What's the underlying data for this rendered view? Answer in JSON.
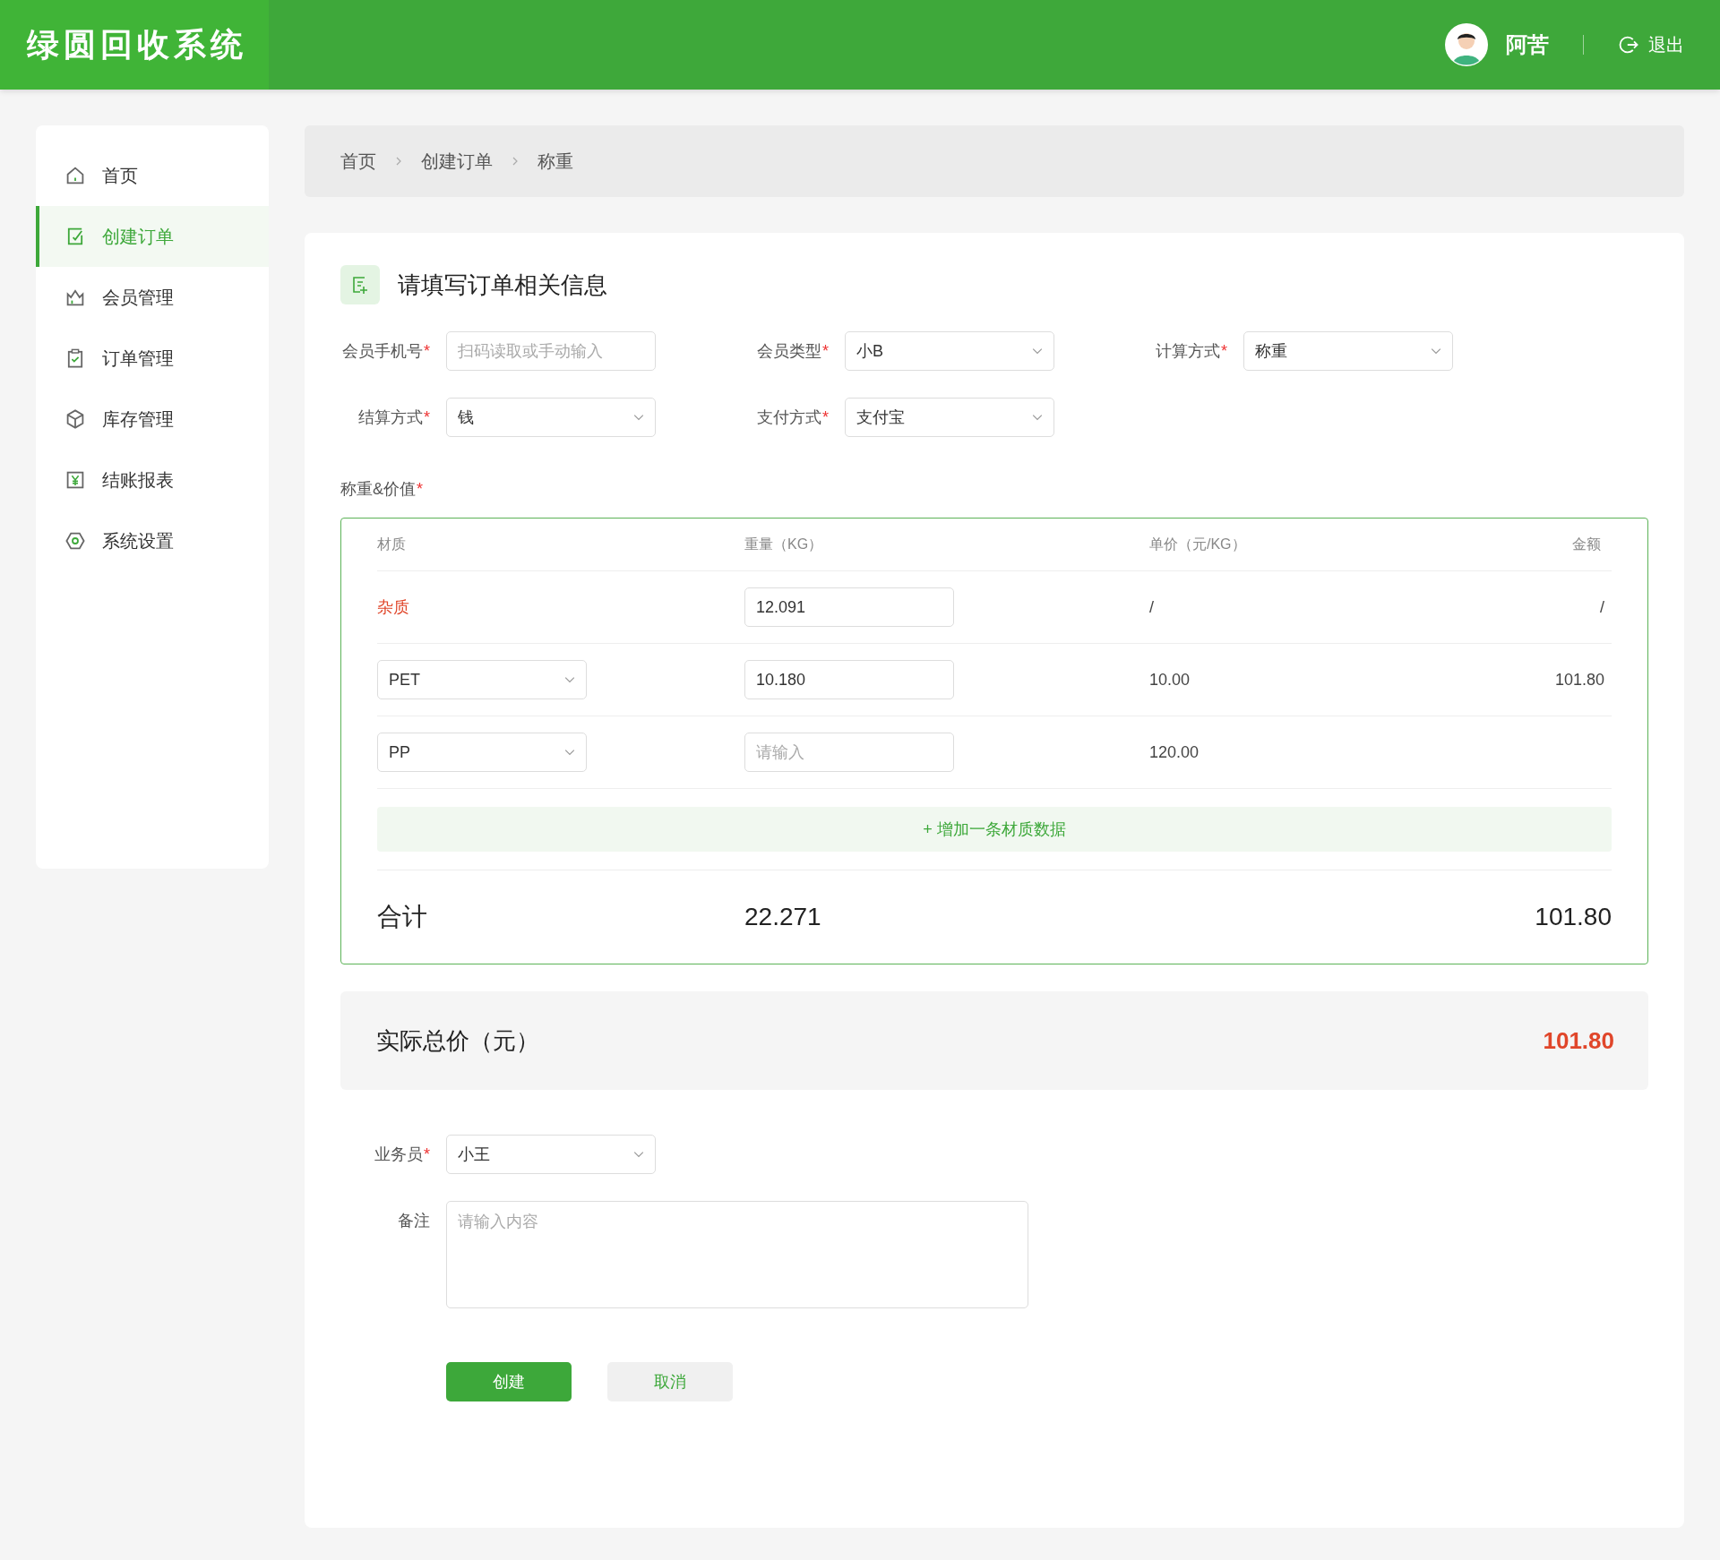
{
  "app_title": "绿圆回收系统",
  "user": {
    "name": "阿苦",
    "logout": "退出"
  },
  "sidebar": {
    "items": [
      {
        "label": "首页",
        "selected": false
      },
      {
        "label": "创建订单",
        "selected": true
      },
      {
        "label": "会员管理",
        "selected": false
      },
      {
        "label": "订单管理",
        "selected": false
      },
      {
        "label": "库存管理",
        "selected": false
      },
      {
        "label": "结账报表",
        "selected": false
      },
      {
        "label": "系统设置",
        "selected": false
      }
    ]
  },
  "breadcrumb": [
    "首页",
    "创建订单",
    "称重"
  ],
  "required_mark": "*",
  "form": {
    "title": "请填写订单相关信息",
    "rows": [
      [
        {
          "label": "会员手机号",
          "required": true,
          "kind": "input",
          "placeholder": "扫码读取或手动输入"
        },
        {
          "label": "会员类型",
          "required": true,
          "kind": "select",
          "value": "小B"
        },
        {
          "label": "计算方式",
          "required": true,
          "kind": "select",
          "value": "称重"
        }
      ],
      [
        {
          "label": "结算方式",
          "required": true,
          "kind": "select",
          "value": "钱"
        },
        {
          "label": "支付方式",
          "required": true,
          "kind": "select",
          "value": "支付宝"
        }
      ]
    ]
  },
  "weighing": {
    "label": "称重&价值",
    "required": true,
    "columns": [
      "材质",
      "重量（KG）",
      "单价（元/KG）",
      "金额"
    ],
    "rows": [
      {
        "kind": "impurity",
        "material": "杂质",
        "weight": "12.091",
        "price": "/",
        "amount": "/"
      },
      {
        "kind": "select",
        "material": "PET",
        "weight": "10.180",
        "price": "10.00",
        "amount": "101.80"
      },
      {
        "kind": "select",
        "material": "PP",
        "weight_placeholder": "请输入",
        "price": "120.00"
      }
    ],
    "add_button": "+ 增加一条材质数据",
    "total": {
      "label": "合计",
      "weight": "22.271",
      "amount": "101.80"
    }
  },
  "actual_total": {
    "label": "实际总价（元）",
    "value": "101.80"
  },
  "bottom_fields": [
    {
      "label": "业务员",
      "required": true,
      "kind": "select",
      "value": "小王"
    },
    {
      "label": "备注",
      "required": false,
      "kind": "textarea",
      "placeholder": "请输入内容"
    }
  ],
  "buttons": [
    {
      "label": "创建",
      "kind": "primary"
    },
    {
      "label": "取消",
      "kind": "secondary"
    }
  ]
}
